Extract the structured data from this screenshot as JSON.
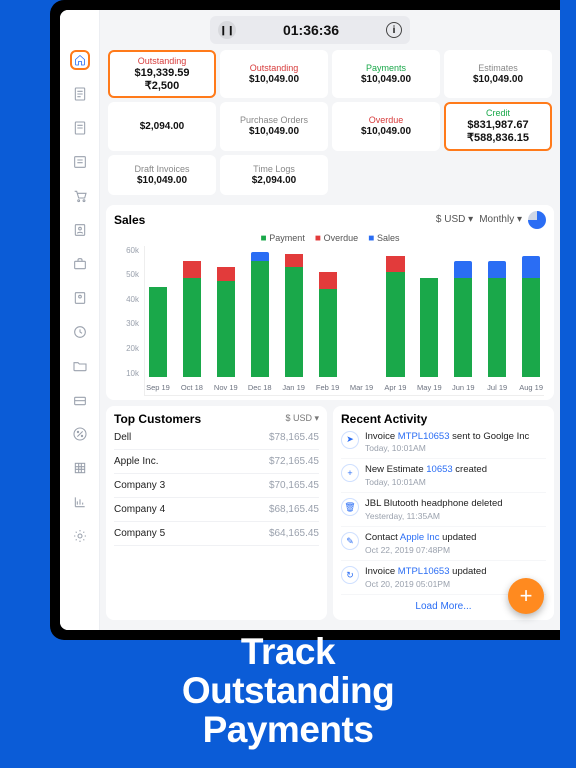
{
  "timer": {
    "value": "01:36:36"
  },
  "stats": {
    "row": [
      {
        "label": "Outstanding",
        "cls": "red",
        "v1": "$19,339.59",
        "v2": "₹2,500",
        "hl": true
      },
      {
        "label": "Outstanding",
        "cls": "red",
        "v1": "$10,049.00"
      },
      {
        "label": "Payments",
        "cls": "green",
        "v1": "$10,049.00"
      },
      {
        "label": "Estimates",
        "cls": "",
        "v1": "$10,049.00"
      },
      {
        "label": "",
        "cls": "",
        "v1": "$2,094.00"
      },
      {
        "label": "Purchase Orders",
        "cls": "",
        "v1": "$10,049.00"
      },
      {
        "label": "Overdue",
        "cls": "red",
        "v1": "$10,049.00"
      },
      {
        "label": "Credit",
        "cls": "green",
        "v1": "$831,987.67",
        "v2": "₹588,836.15",
        "hl": true
      },
      {
        "label": "Draft Invoices",
        "cls": "",
        "v1": "$10,049.00"
      },
      {
        "label": "Time Logs",
        "cls": "",
        "v1": "$2,094.00"
      }
    ]
  },
  "sales": {
    "title": "Sales",
    "currency": "$ USD ▾",
    "period": "Monthly ▾",
    "legend": {
      "payment": "Payment",
      "overdue": "Overdue",
      "sales": "Sales"
    },
    "yticks": [
      "60k",
      "50k",
      "40k",
      "30k",
      "20k",
      "10k"
    ]
  },
  "chart_data": {
    "type": "bar",
    "ylim": [
      0,
      60
    ],
    "ylabel": "k",
    "categories": [
      "Sep 19",
      "Oct 18",
      "Nov 19",
      "Dec 18",
      "Jan 19",
      "Feb 19",
      "Mar 19",
      "Apr 19",
      "May 19",
      "Jun 19",
      "Jul 19",
      "Aug 19"
    ],
    "series": [
      {
        "name": "Payment",
        "color": "#1aa84a",
        "values": [
          41,
          45,
          44,
          53,
          50,
          40,
          0,
          48,
          45,
          45,
          45,
          45
        ]
      },
      {
        "name": "Overdue",
        "color": "#e23b3b",
        "values": [
          0,
          8,
          6,
          0,
          6,
          8,
          0,
          7,
          0,
          0,
          0,
          0
        ]
      },
      {
        "name": "Sales",
        "color": "#2a6df4",
        "values": [
          0,
          0,
          0,
          4,
          0,
          0,
          0,
          0,
          0,
          8,
          8,
          10
        ]
      }
    ]
  },
  "top_customers": {
    "title": "Top Customers",
    "currency": "$ USD ▾",
    "rows": [
      {
        "name": "Dell",
        "amt": "$78,165.45"
      },
      {
        "name": "Apple Inc.",
        "amt": "$72,165.45"
      },
      {
        "name": "Company 3",
        "amt": "$70,165.45"
      },
      {
        "name": "Company 4",
        "amt": "$68,165.45"
      },
      {
        "name": "Company 5",
        "amt": "$64,165.45"
      }
    ]
  },
  "activity": {
    "title": "Recent Activity",
    "items": [
      {
        "ico": "➤",
        "pre": "Invoice ",
        "link": "MTPL10653",
        "post": " sent to Goolge Inc",
        "date": "Today, 10:01AM"
      },
      {
        "ico": "+",
        "pre": "New Estimate ",
        "link": "10653",
        "post": " created",
        "date": "Today, 10:01AM"
      },
      {
        "ico": "🗑",
        "pre": "JBL Blutooth headphone deleted",
        "link": "",
        "post": "",
        "date": "Yesterday, 11:35AM"
      },
      {
        "ico": "✎",
        "pre": "Contact ",
        "link": "Apple Inc",
        "post": " updated",
        "date": "Oct 22, 2019 07:48PM"
      },
      {
        "ico": "↻",
        "pre": "Invoice ",
        "link": "MTPL10653",
        "post": " updated",
        "date": "Oct 20, 2019 05:01PM"
      }
    ],
    "load_more": "Load More..."
  },
  "tagline": {
    "l1": "Track",
    "l2": "Outstanding",
    "l3": "Payments"
  }
}
